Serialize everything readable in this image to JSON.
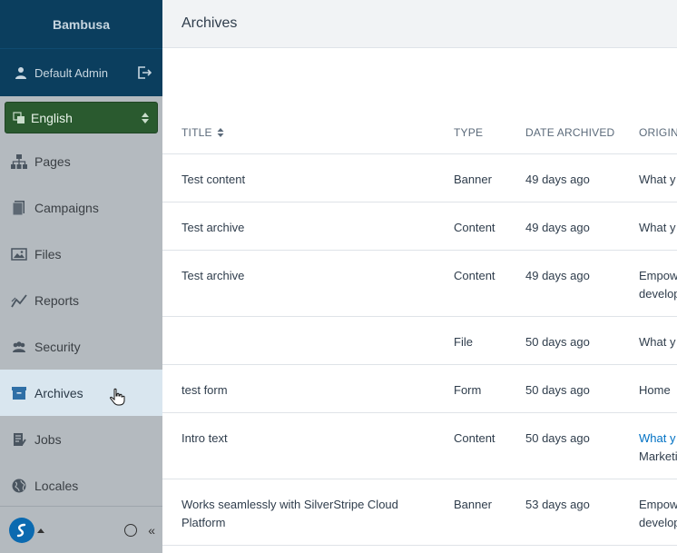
{
  "sidebar": {
    "brand": "Bambusa",
    "user": "Default Admin",
    "locale": "English",
    "items": [
      {
        "label": "Pages",
        "icon": "sitemap-icon"
      },
      {
        "label": "Campaigns",
        "icon": "document-icon"
      },
      {
        "label": "Files",
        "icon": "image-icon"
      },
      {
        "label": "Reports",
        "icon": "chart-line-icon"
      },
      {
        "label": "Security",
        "icon": "users-icon"
      },
      {
        "label": "Archives",
        "icon": "archive-box-icon",
        "active": true
      },
      {
        "label": "Jobs",
        "icon": "list-icon"
      },
      {
        "label": "Locales",
        "icon": "globe-icon"
      }
    ],
    "collapse_glyph": "«"
  },
  "header": {
    "title": "Archives"
  },
  "table": {
    "columns": [
      "TITLE",
      "TYPE",
      "DATE ARCHIVED",
      "ORIGIN"
    ],
    "rows": [
      {
        "title": "Test content",
        "type": "Banner",
        "date": "49 days ago",
        "origin1": "What y",
        "origin2": ""
      },
      {
        "title": "Test archive",
        "type": "Content",
        "date": "49 days ago",
        "origin1": "What y",
        "origin2": ""
      },
      {
        "title": "Test archive",
        "type": "Content",
        "date": "49 days ago",
        "origin1": "Empow",
        "origin2": "develop"
      },
      {
        "title": "",
        "type": "File",
        "date": "50 days ago",
        "origin1": "What y",
        "origin2": ""
      },
      {
        "title": "test form",
        "type": "Form",
        "date": "50 days ago",
        "origin1": "Home",
        "origin2": ""
      },
      {
        "title": "Intro text",
        "type": "Content",
        "date": "50 days ago",
        "origin1": "What y",
        "origin2": "Marketi",
        "origin_link": true
      },
      {
        "title": "Works seamlessly with SilverStripe Cloud Platform",
        "type": "Banner",
        "date": "53 days ago",
        "origin1": "Empow",
        "origin2": "develop"
      }
    ]
  },
  "colors": {
    "brand_bar": "#0b3e5e",
    "locale_green": "#2a5a2f",
    "sidebar_bg": "#b4babf",
    "active_item": "#d9e6ef",
    "link": "#0071c4"
  }
}
